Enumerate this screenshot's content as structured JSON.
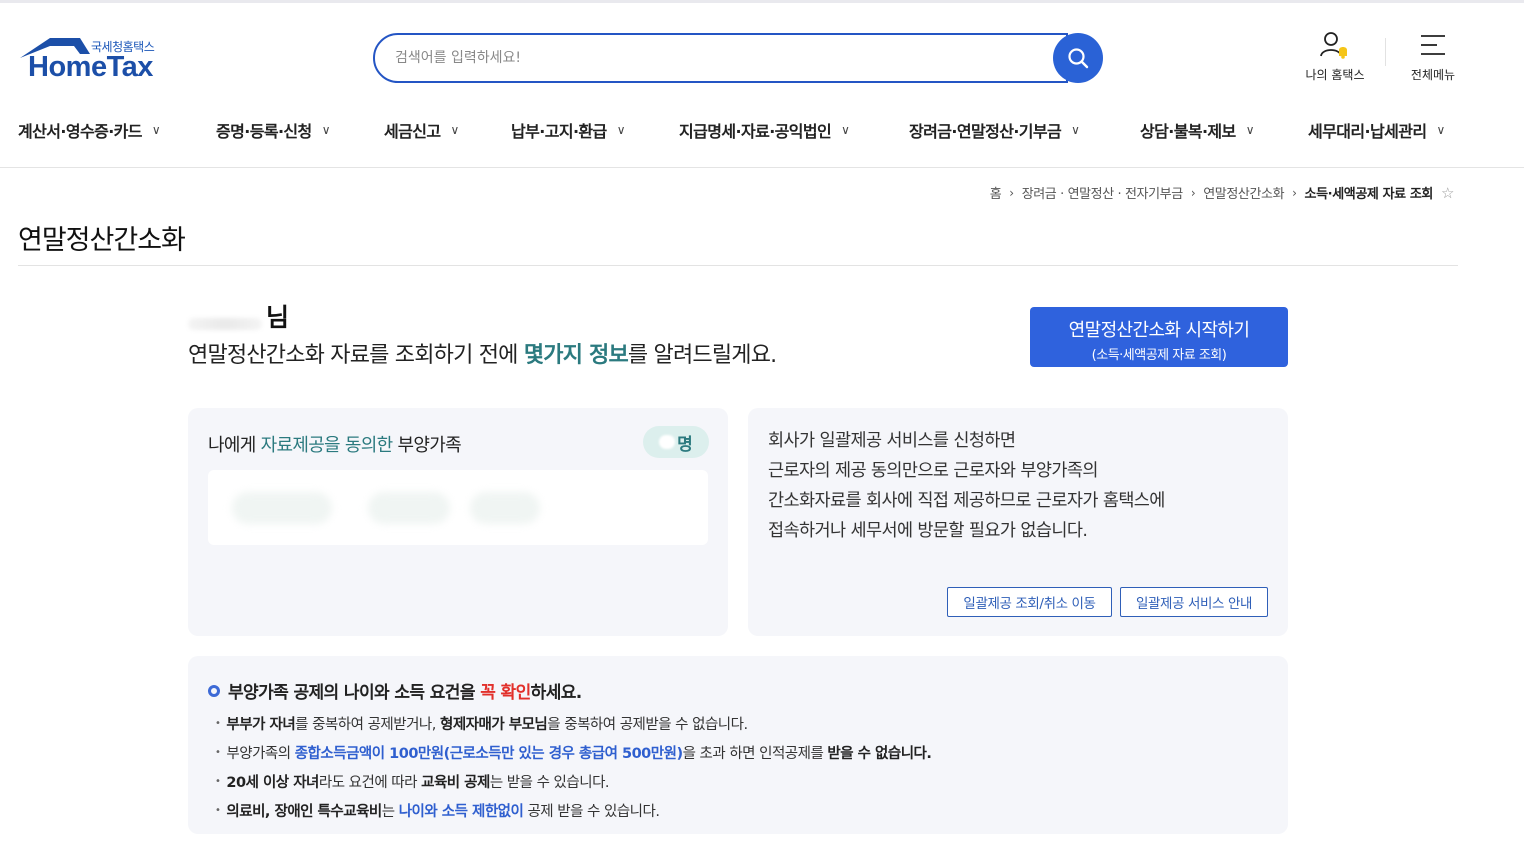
{
  "header": {
    "logo_sub": "국세청홈택스",
    "logo_main": "HomeTax",
    "search_placeholder": "검색어를 입력하세요!",
    "my_hometax": "나의 홈택스",
    "all_menu": "전체메뉴"
  },
  "gnb": [
    "계산서·영수증·카드",
    "증명·등록·신청",
    "세금신고",
    "납부·고지·환급",
    "지급명세·자료·공익법인",
    "장려금·연말정산·기부금",
    "상담·불복·제보",
    "세무대리·납세관리"
  ],
  "breadcrumb": {
    "home": "홈",
    "level1": "장려금 · 연말정산 · 전자기부금",
    "level2": "연말정산간소화",
    "current": "소득·세액공제 자료 조회"
  },
  "page_title": "연말정산간소화",
  "intro": {
    "nim": "님",
    "text_before": "연말정산간소화 자료를 조회하기 전에 ",
    "highlight": "몇가지 정보",
    "text_after": "를 알려드릴게요."
  },
  "start_button": {
    "line1": "연말정산간소화 시작하기",
    "line2": "(소득·세액공제 자료 조회)"
  },
  "dependents": {
    "prefix": "나에게 ",
    "highlight": "자료제공을 동의한",
    "suffix": " 부양가족",
    "count_unit": "명"
  },
  "bulk_info": {
    "lines": [
      "회사가 일괄제공 서비스를 신청하면",
      "근로자의 제공 동의만으로 근로자와 부양가족의",
      "간소화자료를 회사에 직접 제공하므로 근로자가 홈택스에",
      "접속하거나 세무서에 방문할 필요가 없습니다."
    ],
    "btn_move": "일괄제공 조회/취소 이동",
    "btn_guide": "일괄제공 서비스 안내"
  },
  "notice": {
    "title_before": "부양가족 공제의 나이와 소득 요건을 ",
    "title_red": "꼭 확인",
    "title_after": "하세요.",
    "item1": {
      "b1": "부부가 자녀",
      "t1": "를 중복하여 공제받거나, ",
      "b2": "형제자매가 부모님",
      "t2": "을 중복하여 공제받을 수 없습니다."
    },
    "item2": {
      "t1": "부양가족의 ",
      "blue": "종합소득금액이 100만원(근로소득만 있는 경우 총급여 500만원)",
      "t2": "을 초과 하면 인적공제를 ",
      "b1": "받을 수 없습니다."
    },
    "item3": {
      "b1": "20세 이상 자녀",
      "t1": "라도 요건에 따라 ",
      "b2": "교육비 공제",
      "t2": "는 받을 수 있습니다."
    },
    "item4": {
      "b1": "의료비, 장애인 특수교육비",
      "t1": "는 ",
      "blue": "나이와 소득 제한없이",
      "t2": " 공제 받을 수 있습니다."
    }
  },
  "colors": {
    "brand_blue": "#2f62dd",
    "teal": "#2b7a7f",
    "red": "#e2302b",
    "card_bg": "#f5f6fa"
  }
}
